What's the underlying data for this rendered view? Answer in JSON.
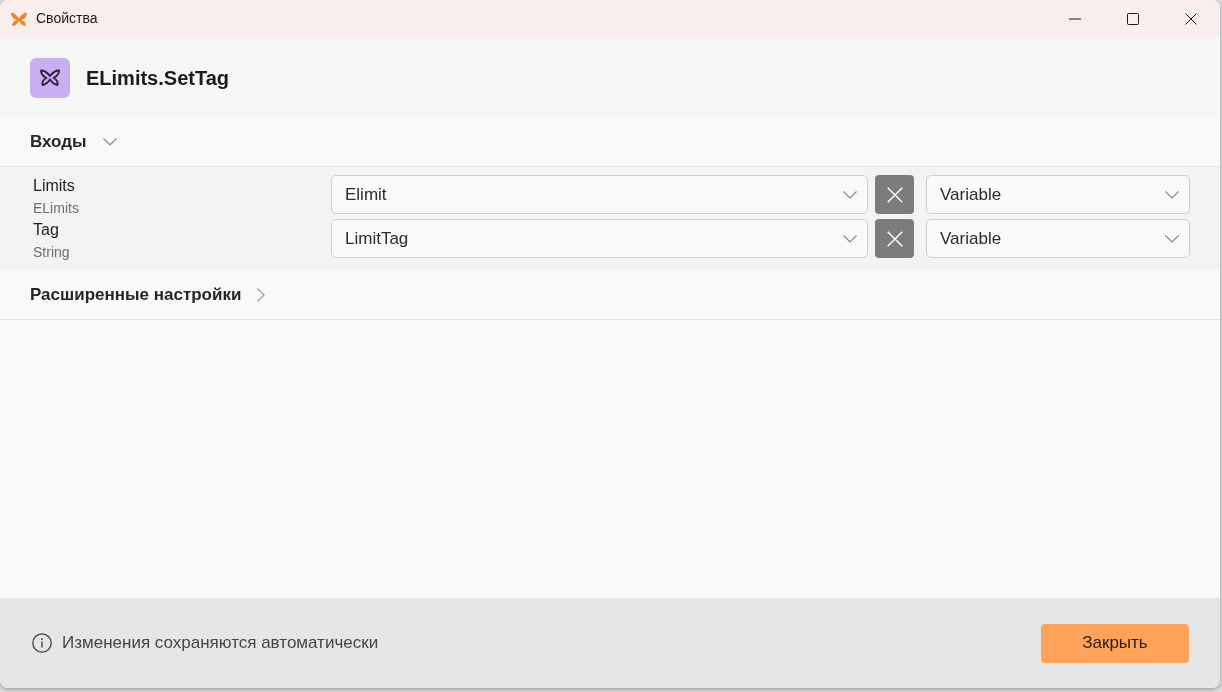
{
  "window": {
    "title": "Свойства"
  },
  "header": {
    "title": "ELimits.SetTag"
  },
  "sections": [
    {
      "title": "Входы",
      "expanded": true,
      "params": [
        {
          "name": "Limits",
          "type": "ELimits",
          "value": "Elimit",
          "mode": "Variable"
        },
        {
          "name": "Tag",
          "type": "String",
          "value": "LimitTag",
          "mode": "Variable"
        }
      ]
    },
    {
      "title": "Расширенные настройки",
      "expanded": false
    }
  ],
  "footer": {
    "note": "Изменения сохраняются автоматически",
    "button": "Закрыть"
  }
}
